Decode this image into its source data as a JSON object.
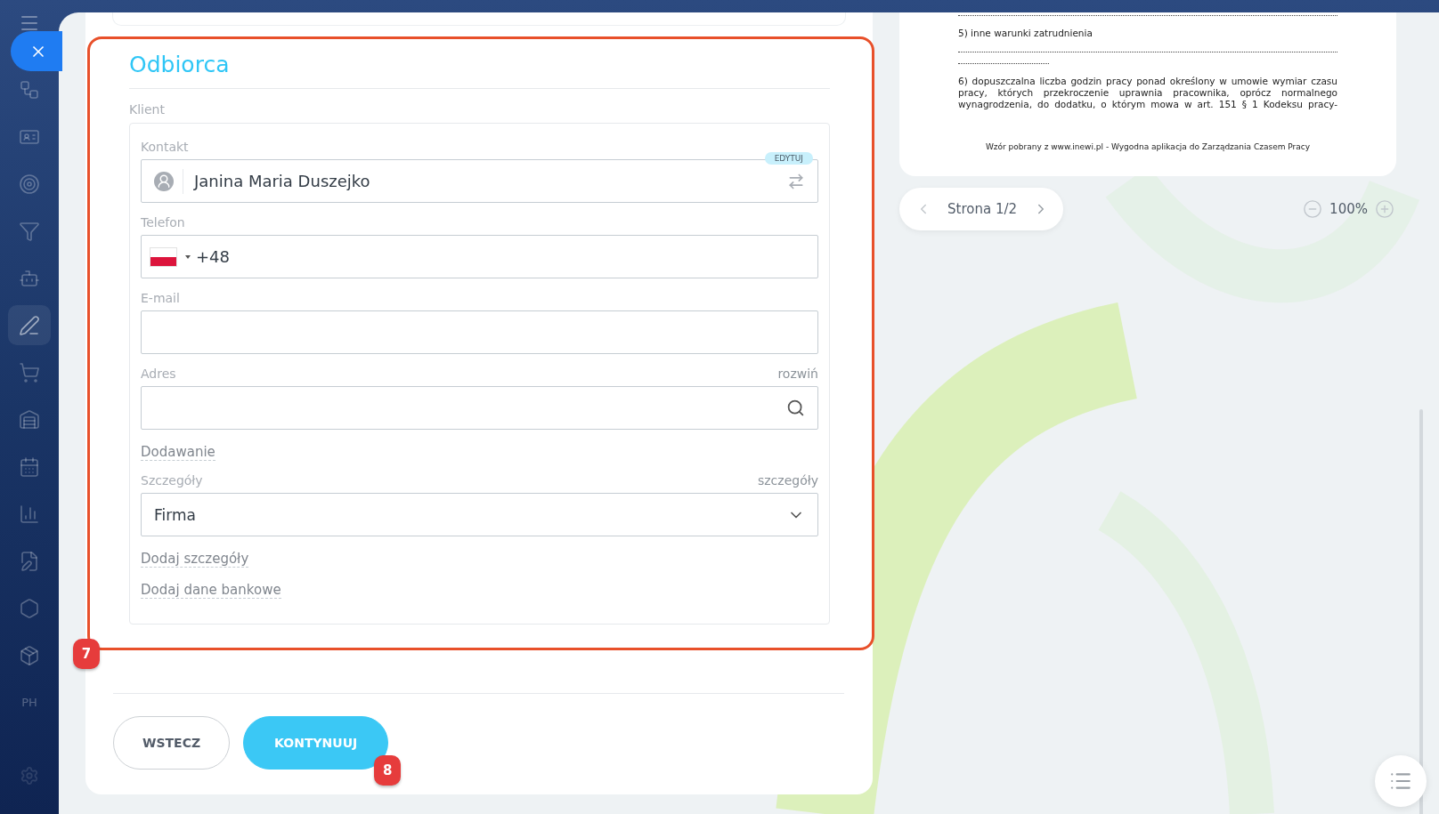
{
  "sidebar": {
    "items": [
      {
        "kind": "icon",
        "selected": false
      },
      {
        "kind": "icon",
        "selected": false
      },
      {
        "kind": "icon",
        "selected": false
      },
      {
        "kind": "icon",
        "selected": false
      },
      {
        "kind": "icon",
        "selected": false
      },
      {
        "kind": "icon",
        "selected": true
      },
      {
        "kind": "icon",
        "selected": false
      },
      {
        "kind": "icon",
        "selected": false
      },
      {
        "kind": "icon",
        "selected": false
      },
      {
        "kind": "icon",
        "selected": false
      },
      {
        "kind": "icon",
        "selected": false
      },
      {
        "kind": "icon",
        "selected": false
      },
      {
        "kind": "icon",
        "selected": false
      },
      {
        "kind": "text",
        "label": "PH",
        "selected": false
      }
    ]
  },
  "section": {
    "title": "Odbiorca",
    "group_label": "Klient",
    "fields": [
      {
        "kind": "contact",
        "label": "Kontakt",
        "value": "Janina Maria Duszejko",
        "badge": "EDYTUJ"
      },
      {
        "kind": "phone",
        "label": "Telefon",
        "value": "+48"
      },
      {
        "kind": "text",
        "label": "E-mail"
      },
      {
        "kind": "search",
        "label": "Adres",
        "action": "rozwiń"
      },
      {
        "kind": "link",
        "label": "Dodawanie"
      },
      {
        "kind": "select",
        "label": "Szczegóły",
        "action": "szczegóły",
        "value": "Firma"
      },
      {
        "kind": "link",
        "label": "Dodaj szczegóły"
      },
      {
        "kind": "link",
        "label": "Dodaj dane bankowe"
      }
    ],
    "annotation": "7"
  },
  "buttons": [
    {
      "label": "WSTECZ",
      "primary": false
    },
    {
      "label": "KONTYNUUJ",
      "primary": true,
      "annotation": "8"
    }
  ],
  "document": {
    "lines": [
      {
        "kind": "dots"
      },
      {
        "kind": "text",
        "text": "5) inne warunki zatrudnienia"
      },
      {
        "kind": "dots"
      },
      {
        "kind": "dots_short"
      },
      {
        "kind": "paragraph",
        "text": "6) dopuszczalna liczba godzin pracy ponad określony w umowie wymiar czasu pracy, których przekroczenie uprawnia pracownika, oprócz normalnego wynagrodzenia, do dodatku, o którym mowa w art. 151 § 1 Kodeksu pracy-"
      },
      {
        "kind": "footer",
        "text": "Wzór pobrany z www.inewi.pl - Wygodna aplikacja do Zarządzania Czasem Pracy"
      }
    ]
  },
  "pager": {
    "label": "Strona 1/2"
  },
  "zoom": {
    "label": "100%"
  }
}
